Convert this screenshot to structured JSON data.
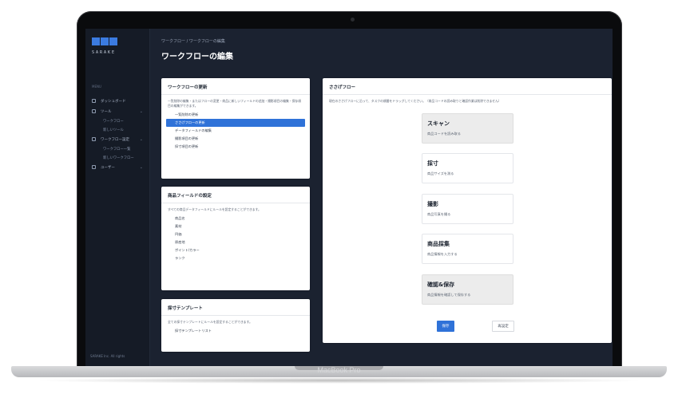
{
  "device": {
    "label": "MacBook Pro"
  },
  "sidebar": {
    "logo_text": "SARAKE",
    "section_label": "MENU",
    "items": [
      {
        "label": "ダッシュボード",
        "icon": "home-icon"
      },
      {
        "label": "ツール",
        "icon": "tool-icon"
      },
      {
        "label": "ワークフロー設定",
        "icon": "workflow-icon"
      },
      {
        "label": "ユーザー",
        "icon": "user-icon"
      }
    ],
    "subitems_tools": [
      "ワークフロー",
      "新しいツール"
    ],
    "subitems_workflow": [
      "ワークフロー一覧",
      "新しいワークフロー"
    ],
    "footer": "SARAKE Inc. All rights"
  },
  "header": {
    "breadcrumb": "ワークフロー / ワークフローの編集",
    "title": "ワークフローの編集"
  },
  "workflow_settings": {
    "title": "ワークフローの更新",
    "description": "一覧削除の編集・またはフローの変更・商品に新しいフィールドの追加・撮影項目の編集・保存項目の編集ができます。",
    "options": [
      "一覧削除の更新",
      "ささげフローの更新",
      "データフィールドの編集",
      "撮影項目の更新",
      "採寸項目の更新"
    ],
    "active_index": 1
  },
  "product_fields": {
    "title": "商品フィールドの設定",
    "description": "すべての商品データフィールドにルールを設定することができます。",
    "fields": [
      "商品名",
      "素材",
      "円価",
      "原産地",
      "ポイント/カラー",
      "ランク"
    ]
  },
  "size_templates": {
    "title": "採寸テンプレート",
    "description": "全ての採寸テンプレートにルールを設定することができます。",
    "link": "採寸テンプレートリスト"
  },
  "flow": {
    "title": "ささげフロー",
    "hint": "現在のささげフローに沿って、タスクの順番をドラッグしてください。（商品コードの読み取りと確認作業は削除できません）",
    "steps": [
      {
        "title": "スキャン",
        "desc": "商品コードを読み取る",
        "locked": true
      },
      {
        "title": "採寸",
        "desc": "商品サイズを測る",
        "locked": false
      },
      {
        "title": "撮影",
        "desc": "商品写真を撮る",
        "locked": false
      },
      {
        "title": "商品採集",
        "desc": "商品情報を入力する",
        "locked": false
      },
      {
        "title": "確認&保存",
        "desc": "商品情報を確認して保存する",
        "locked": true
      }
    ],
    "save_label": "保存",
    "reset_label": "再設定"
  }
}
